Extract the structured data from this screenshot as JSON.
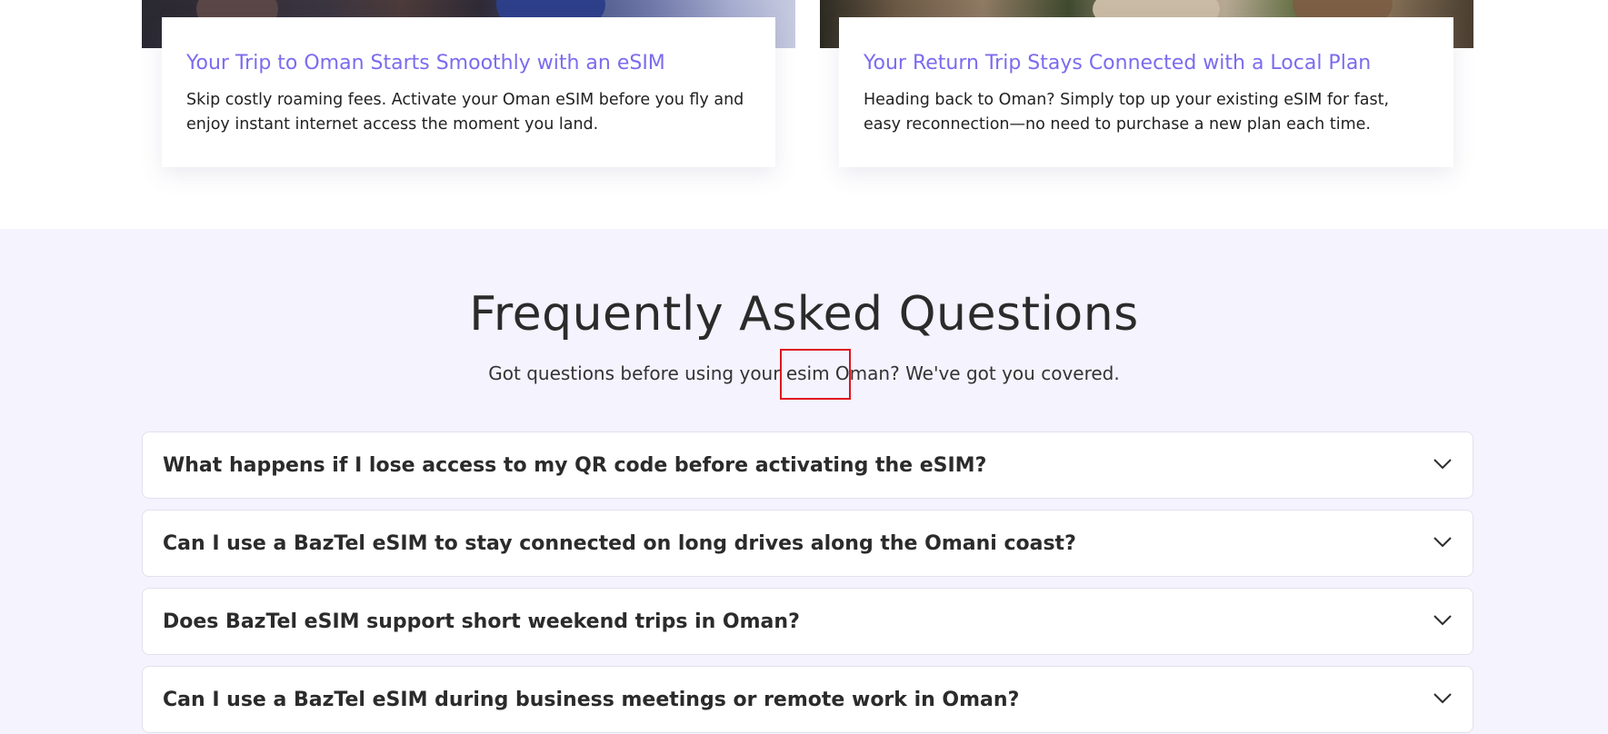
{
  "cards": [
    {
      "title": "Your Trip to Oman Starts Smoothly with an eSIM",
      "text": "Skip costly roaming fees. Activate your Oman eSIM before you fly and enjoy instant internet access the moment you land."
    },
    {
      "title": "Your Return Trip Stays Connected with a Local Plan",
      "text": "Heading back to Oman? Simply top up your existing eSIM for fast, easy reconnection—no need to purchase a new plan each time."
    }
  ],
  "faq": {
    "heading": "Frequently Asked Questions",
    "subheading": "Got questions before using your esim Oman? We've got you covered.",
    "items": [
      {
        "question": "What happens if I lose access to my QR code before activating the eSIM?",
        "icon": "chevron-down-icon"
      },
      {
        "question": "Can I use a BazTel eSIM to stay connected on long drives along the Omani coast?",
        "icon": "chevron-down-icon"
      },
      {
        "question": "Does BazTel eSIM support short weekend trips in Oman?",
        "icon": "chevron-down-icon"
      },
      {
        "question": "Can I use a BazTel eSIM during business meetings or remote work in Oman?",
        "icon": "chevron-down-icon"
      }
    ]
  },
  "colors": {
    "card_title": "#7b6bef",
    "faq_background": "#f4f3fe",
    "highlight": "#e0141e"
  }
}
